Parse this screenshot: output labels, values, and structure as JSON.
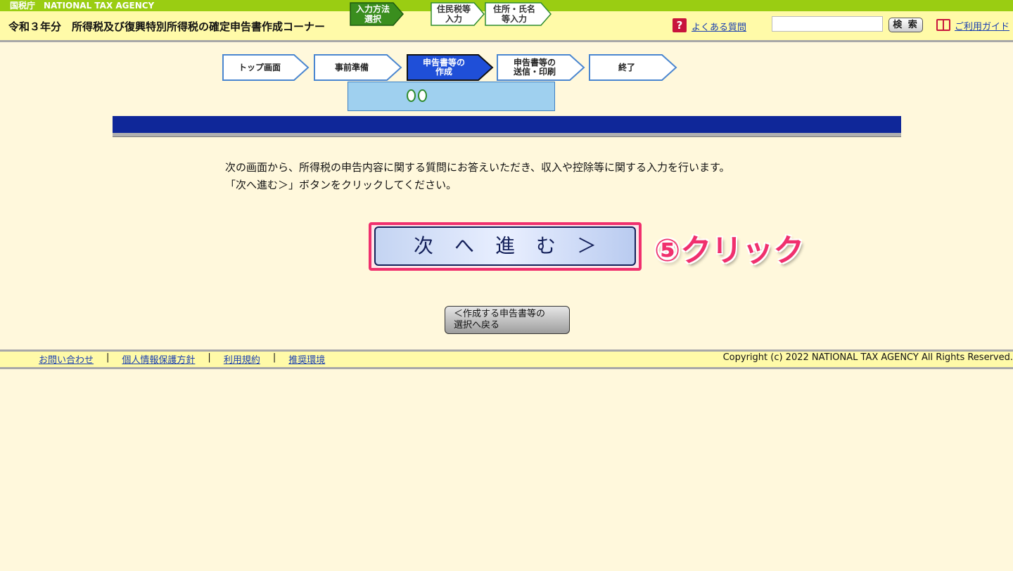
{
  "agency_bar": {
    "label": "国税庁　NATIONAL TAX AGENCY"
  },
  "header": {
    "title": "令和３年分　所得税及び復興特別所得税の確定申告書作成コーナー",
    "faq_icon": "?",
    "faq_label": "よくある質問",
    "search_placeholder": "",
    "search_button": "検 索",
    "guide_label": "ご利用ガイド"
  },
  "steps": [
    {
      "label": "トップ画面",
      "state": "done"
    },
    {
      "label": "事前準備",
      "state": "done"
    },
    {
      "label": "申告書等の\n作成",
      "state": "active"
    },
    {
      "label": "申告書等の\n送信・印刷",
      "state": "todo"
    },
    {
      "label": "終了",
      "state": "todo"
    }
  ],
  "substeps": [
    {
      "label": "入力方法\n選択",
      "state": "active"
    },
    {
      "label": "住民税等\n入力",
      "state": "todo"
    },
    {
      "label": "住所・氏名\n等入力",
      "state": "todo"
    }
  ],
  "intro": {
    "line1": "次の画面から、所得税の申告内容に関する質問にお答えいただき、収入や控除等に関する入力を行います。",
    "line2": "「次へ進む＞」ボタンをクリックしてください。"
  },
  "next_button": {
    "label": "次へ進む＞"
  },
  "annotation": {
    "label": "⑤クリック"
  },
  "back_button": {
    "label": "＜作成する申告書等の\n選択へ戻る"
  },
  "footer": {
    "links": [
      "お問い合わせ",
      "個人情報保護方針",
      "利用規約",
      "推奨環境"
    ],
    "separator": "|",
    "copyright": "Copyright (c) 2022 NATIONAL TAX AGENCY All Rights Reserved."
  },
  "colors": {
    "agency_green": "#9acd12",
    "header_yellow": "#fffaa8",
    "page_bg": "#fff8dc",
    "navy": "#0f2799",
    "highlight_pink": "#f0306e",
    "step_active": "#1f4fd8",
    "substep_active": "#3a8e1e"
  }
}
